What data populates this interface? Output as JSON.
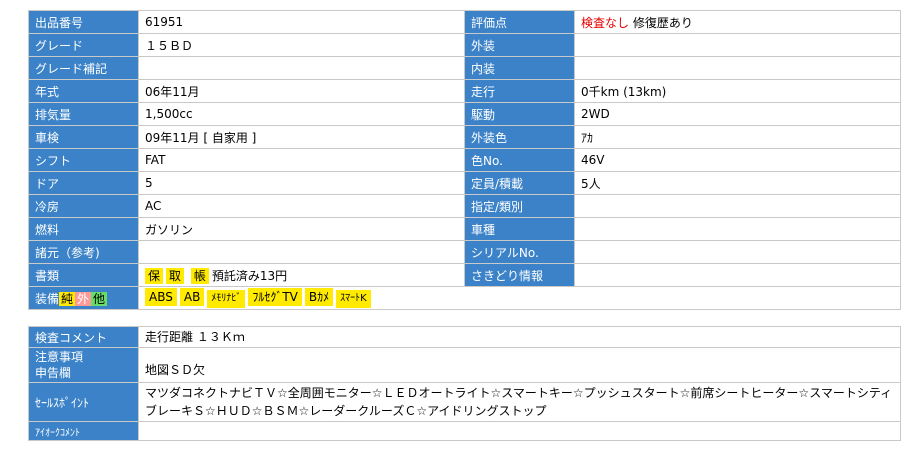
{
  "spec": {
    "lot_label": "出品番号",
    "lot": "61951",
    "eval_label": "評価点",
    "eval_red": "検査なし",
    "eval_rest": "修復歴あり",
    "grade_label": "グレード",
    "grade": "１５ＢＤ",
    "exterior_label": "外装",
    "exterior": "",
    "grade_note_label": "グレード補記",
    "grade_note": "",
    "interior_label": "内装",
    "interior": "",
    "year_label": "年式",
    "year": "06年11月",
    "mileage_label": "走行",
    "mileage": "0千km (13km)",
    "displacement_label": "排気量",
    "displacement": "1,500cc",
    "drive_label": "駆動",
    "drive": "2WD",
    "inspection_label": "車検",
    "inspection": "09年11月 [ 自家用 ]",
    "color_label": "外装色",
    "color": "ｱｶ",
    "shift_label": "シフト",
    "shift": "FAT",
    "color_no_label": "色No.",
    "color_no": "46V",
    "doors_label": "ドア",
    "doors": "5",
    "capacity_label": "定員/積載",
    "capacity": "5人",
    "ac_label": "冷房",
    "ac": "AC",
    "designation_label": "指定/類別",
    "designation": "",
    "fuel_label": "燃料",
    "fuel": "ガソリン",
    "model_label": "車種",
    "model": "",
    "specs_ref_label": "諸元（参考)",
    "specs_ref": "",
    "serial_label": "シリアルNo.",
    "serial": "",
    "docs_label": "書類",
    "doc1": "保",
    "doc2": "取",
    "doc3": "帳",
    "docs_text": "預託済み13円",
    "preview_label": "さきどり情報",
    "preview": "",
    "equip_label": "装備",
    "equip_pure": "純",
    "equip_ext": "外",
    "equip_other": "他",
    "equipment": [
      "ABS",
      "AB",
      "ﾒﾓﾘﾅﾋﾞ",
      "ﾌﾙｾｸﾞTV",
      "Bｶﾒ",
      "ｽﾏｰﾄK"
    ]
  },
  "notes": {
    "inspect_label": "検査コメント",
    "inspect": "走行距離 １３Ｋｍ",
    "caution_label": "注意事項",
    "report_label": "申告欄",
    "report": "地図ＳＤ欠",
    "sales_label": "ｾｰﾙｽﾎﾟｲﾝﾄ",
    "sales": "マツダコネクトナビＴＶ☆全周囲モニター☆ＬＥＤオートライト☆スマートキー☆プッシュスタート☆前席シートヒーター☆スマートシティブレーキＳ☆ＨＵＤ☆ＢＳＭ☆レーダークルーズＣ☆アイドリングストップ",
    "iauc_label": "ｱｲｵｰｸｺﾒﾝﾄ",
    "iauc": ""
  },
  "colors": {
    "label_bg": "#3b82c8",
    "highlight": "#ffea00",
    "alert": "#d00000"
  }
}
